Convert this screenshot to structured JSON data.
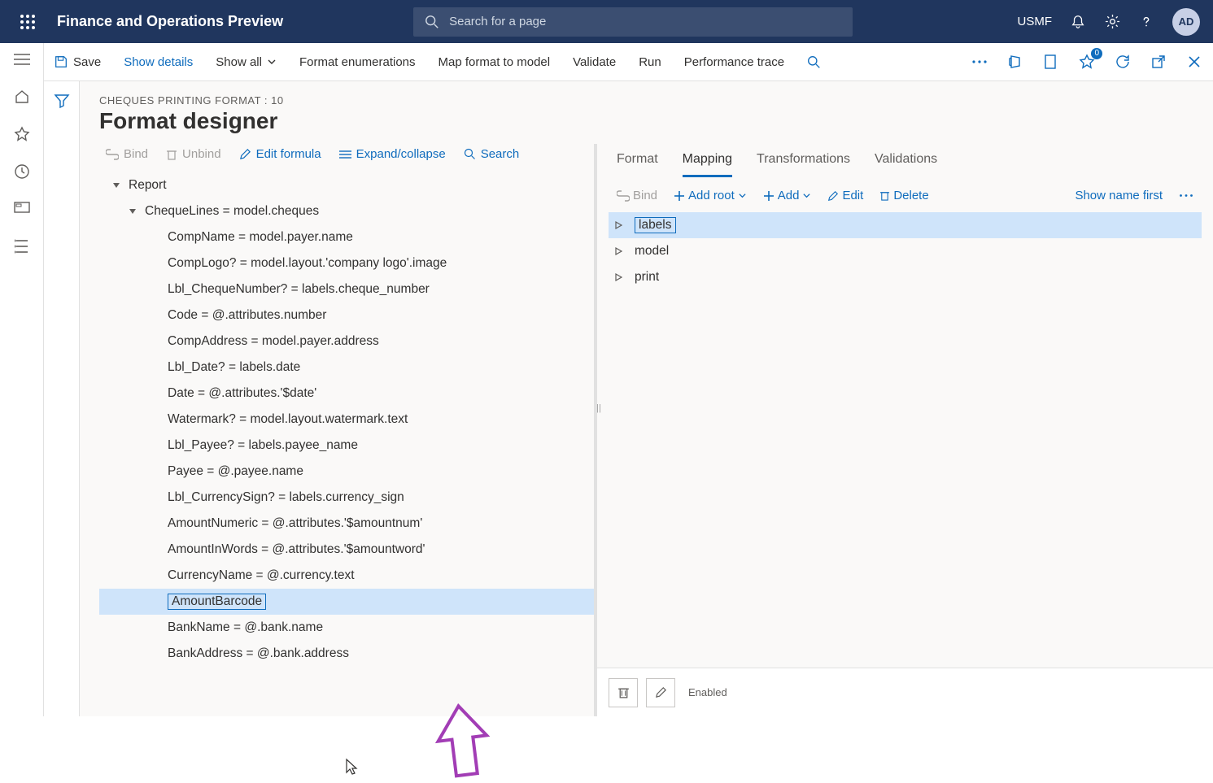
{
  "header": {
    "app_title": "Finance and Operations Preview",
    "search_placeholder": "Search for a page",
    "legal_entity": "USMF",
    "avatar_initials": "AD"
  },
  "cmdbar": {
    "save": "Save",
    "show_details": "Show details",
    "show_all": "Show all",
    "format_enum": "Format enumerations",
    "map_format": "Map format to model",
    "validate": "Validate",
    "run": "Run",
    "perf_trace": "Performance trace",
    "notif_badge": "0"
  },
  "page": {
    "breadcrumb": "CHEQUES PRINTING FORMAT : 10",
    "title": "Format designer"
  },
  "left_toolbar": {
    "bind": "Bind",
    "unbind": "Unbind",
    "edit_formula": "Edit formula",
    "expand": "Expand/collapse",
    "search": "Search"
  },
  "tree": {
    "root": "Report",
    "child": "ChequeLines = model.cheques",
    "items": [
      "CompName = model.payer.name",
      "CompLogo? = model.layout.'company logo'.image",
      "Lbl_ChequeNumber? = labels.cheque_number",
      "Code = @.attributes.number",
      "CompAddress = model.payer.address",
      "Lbl_Date? = labels.date",
      "Date = @.attributes.'$date'",
      "Watermark? = model.layout.watermark.text",
      "Lbl_Payee? = labels.payee_name",
      "Payee = @.payee.name",
      "Lbl_CurrencySign? = labels.currency_sign",
      "AmountNumeric = @.attributes.'$amountnum'",
      "AmountInWords = @.attributes.'$amountword'",
      "CurrencyName = @.currency.text",
      "AmountBarcode",
      "BankName = @.bank.name",
      "BankAddress = @.bank.address"
    ],
    "selected_index": 14
  },
  "tabs": {
    "format": "Format",
    "mapping": "Mapping",
    "transformations": "Transformations",
    "validations": "Validations"
  },
  "map_toolbar": {
    "bind": "Bind",
    "add_root": "Add root",
    "add": "Add",
    "edit": "Edit",
    "delete": "Delete",
    "show_name": "Show name first"
  },
  "datasources": {
    "items": [
      "labels",
      "model",
      "print"
    ],
    "selected_index": 0
  },
  "bottom": {
    "enabled": "Enabled"
  }
}
